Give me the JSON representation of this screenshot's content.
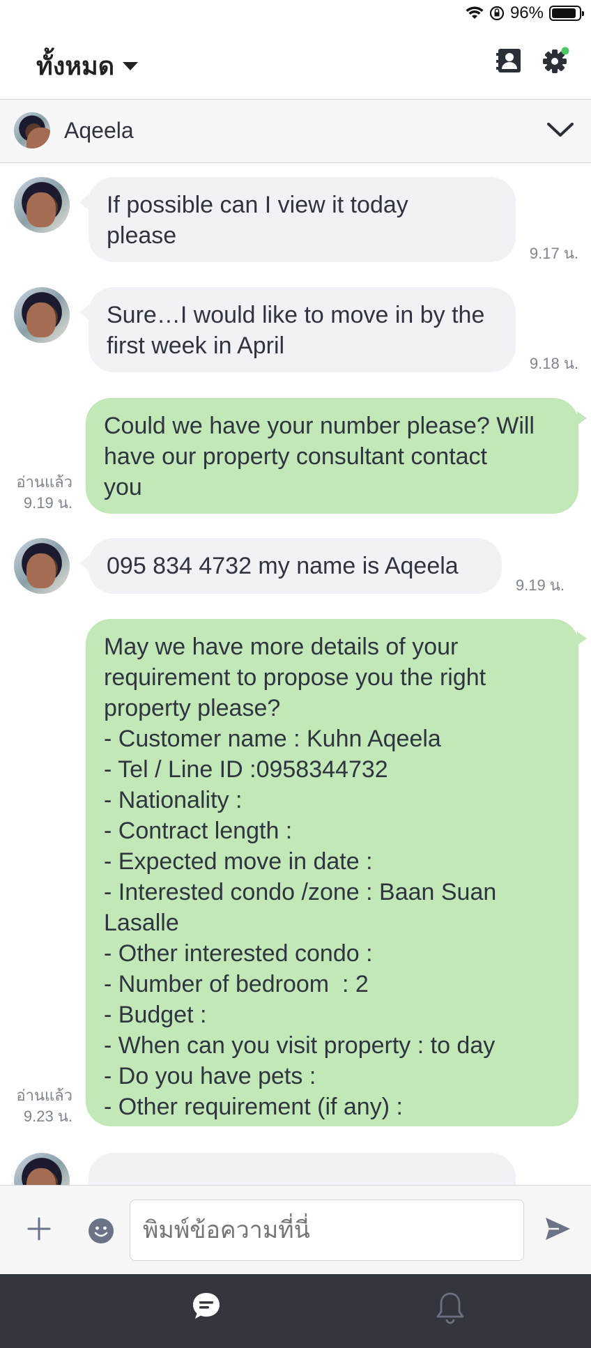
{
  "status": {
    "battery_percent": "96%"
  },
  "header": {
    "title": "ทั้งหมด"
  },
  "chat": {
    "contact_name": "Aqeela"
  },
  "messages": [
    {
      "direction": "in",
      "text": "If possible can I view it today\nplease",
      "time": "9.17 น."
    },
    {
      "direction": "in",
      "text": "Sure…I would like to move in by the\nfirst week in April",
      "time": "9.18 น."
    },
    {
      "direction": "out",
      "text": "Could we have your number please? Will\nhave our property consultant contact\nyou",
      "read": "อ่านแล้ว",
      "time": "9.19 น."
    },
    {
      "direction": "in",
      "text": "095 834 4732 my name is Aqeela",
      "time": "9.19 น."
    },
    {
      "direction": "out",
      "text": "May we have more details of your\nrequirement to propose you the right\nproperty please?\n- Customer name : Kuhn Aqeela\n- Tel / Line ID :0958344732\n- Nationality :\n- Contract length :\n- Expected move in date :\n- Interested condo /zone : Baan Suan\nLasalle\n- Other interested condo :\n- Number of bedroom  : 2\n- Budget :\n- When can you visit property : to day\n- Do you have pets :\n- Other requirement (if any) :",
      "read": "อ่านแล้ว",
      "time": "9.23 น."
    }
  ],
  "input": {
    "placeholder": "พิมพ์ข้อความที่นี่"
  },
  "colors": {
    "outgoing_bubble": "#c1e8b6",
    "incoming_bubble": "#f1f2f5",
    "bottom_nav": "#33363d",
    "settings_dot": "#4cc764"
  }
}
